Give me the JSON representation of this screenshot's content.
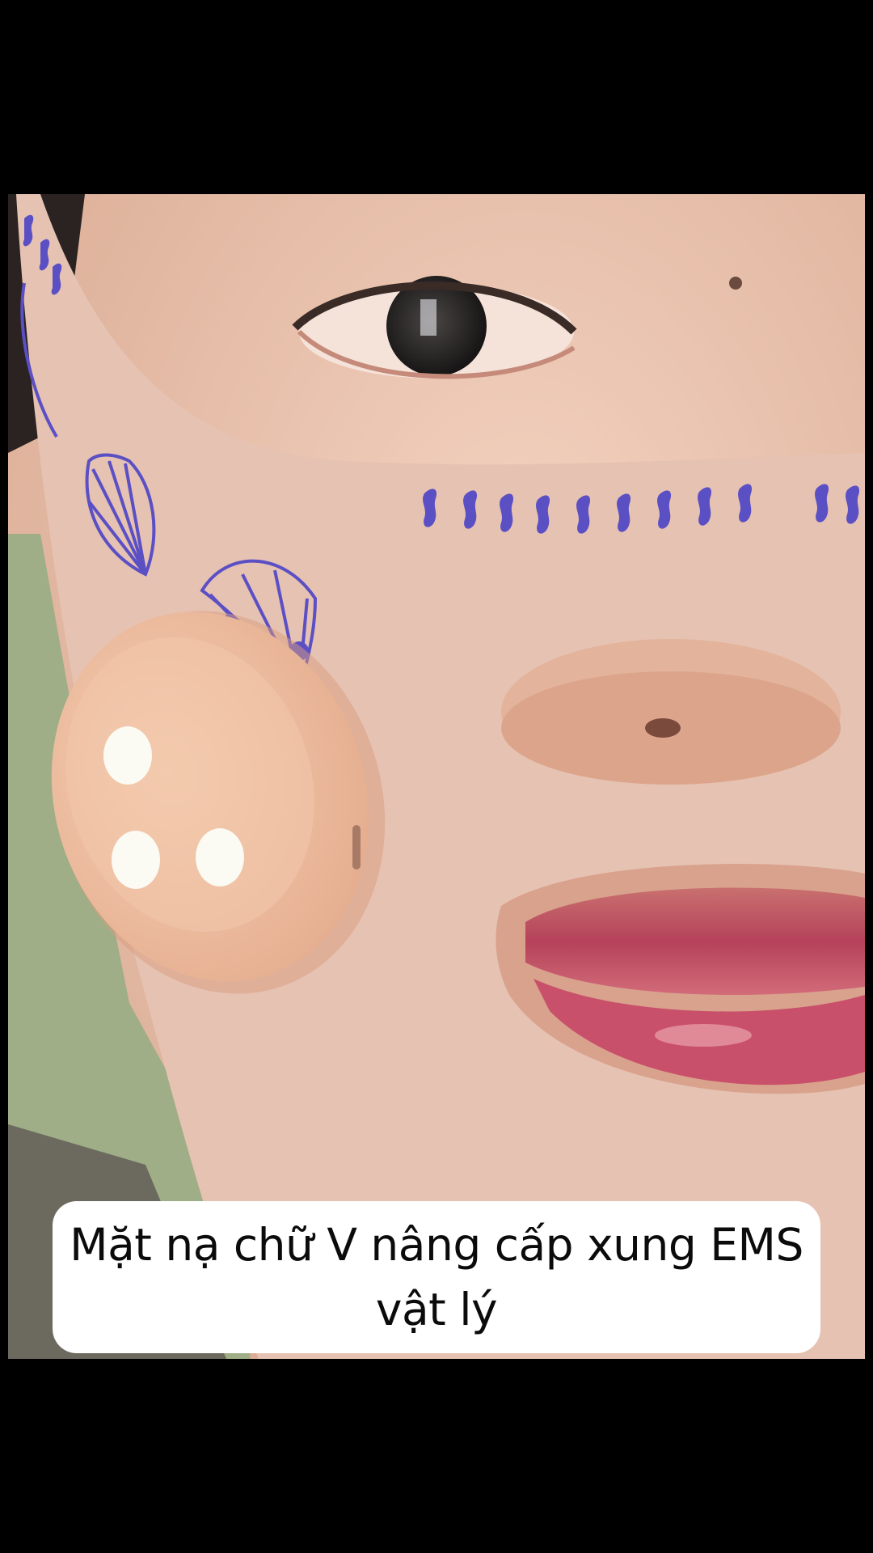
{
  "video": {
    "caption": "Mặt nạ chữ V nâng cấp xung EMS vật lý",
    "caption_line_1": "Mặt nạ chữ V nâng cấp xung EMS",
    "caption_line_2": "vật lý"
  },
  "colors": {
    "background": "#000000",
    "caption_background": "#ffffff",
    "caption_text": "#0b0b0b",
    "mask_band": "#e6c2b3",
    "device": "#f0c2a3",
    "print": "#5b4fc4"
  }
}
